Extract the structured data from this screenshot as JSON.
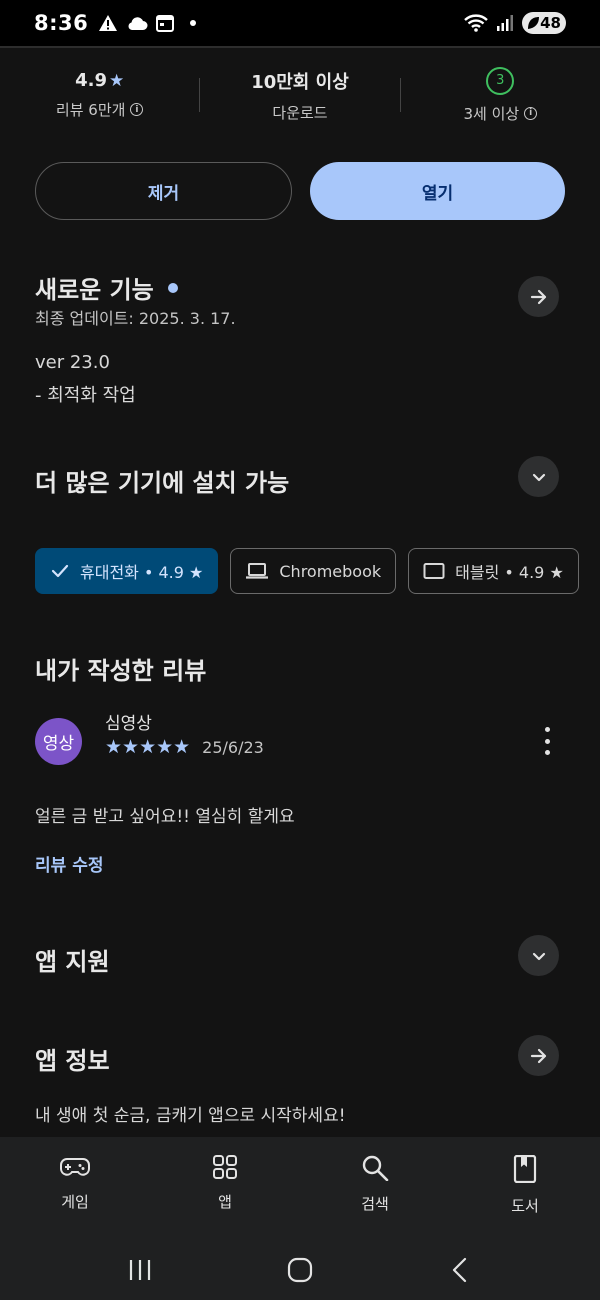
{
  "status_bar": {
    "time": "8:36",
    "battery": "48"
  },
  "stats": {
    "rating": "4.9",
    "rating_star": "★",
    "reviews": "리뷰 6만개",
    "downloads": "10만회 이상",
    "downloads_label": "다운로드",
    "age_badge": "3",
    "age_label": "3세 이상"
  },
  "buttons": {
    "uninstall": "제거",
    "open": "열기"
  },
  "whats_new": {
    "title": "새로운 기능",
    "updated": "최종 업데이트: 2025. 3. 17.",
    "version": "ver 23.0",
    "note": "- 최적화 작업"
  },
  "devices": {
    "title": "더 많은 기기에 설치 가능",
    "chips": [
      {
        "label": "휴대전화 • 4.9 ★",
        "selected": true
      },
      {
        "label": "Chromebook",
        "selected": false
      },
      {
        "label": "태블릿 • 4.9 ★",
        "selected": false
      }
    ]
  },
  "my_review": {
    "title": "내가 작성한 리뷰",
    "avatar_text": "영상",
    "reviewer": "심영상",
    "stars": "★★★★★",
    "rating_value": 5,
    "date": "25/6/23",
    "text": "얼른 금 받고 싶어요!! 열심히 할게요",
    "edit_link": "리뷰 수정"
  },
  "app_support": {
    "title": "앱 지원"
  },
  "app_info": {
    "title": "앱 정보",
    "description": "내 생애 첫 순금, 금캐기 앱으로 시작하세요!"
  },
  "bottom_nav": [
    {
      "label": "게임",
      "icon": "gamepad-icon"
    },
    {
      "label": "앱",
      "icon": "apps-grid-icon"
    },
    {
      "label": "검색",
      "icon": "search-icon"
    },
    {
      "label": "도서",
      "icon": "book-icon"
    }
  ],
  "colors": {
    "accent": "#a8c7fa",
    "background": "#131313",
    "chip_selected": "#004a77",
    "avatar": "#7c54c8",
    "age_badge": "#3fbf5f"
  }
}
